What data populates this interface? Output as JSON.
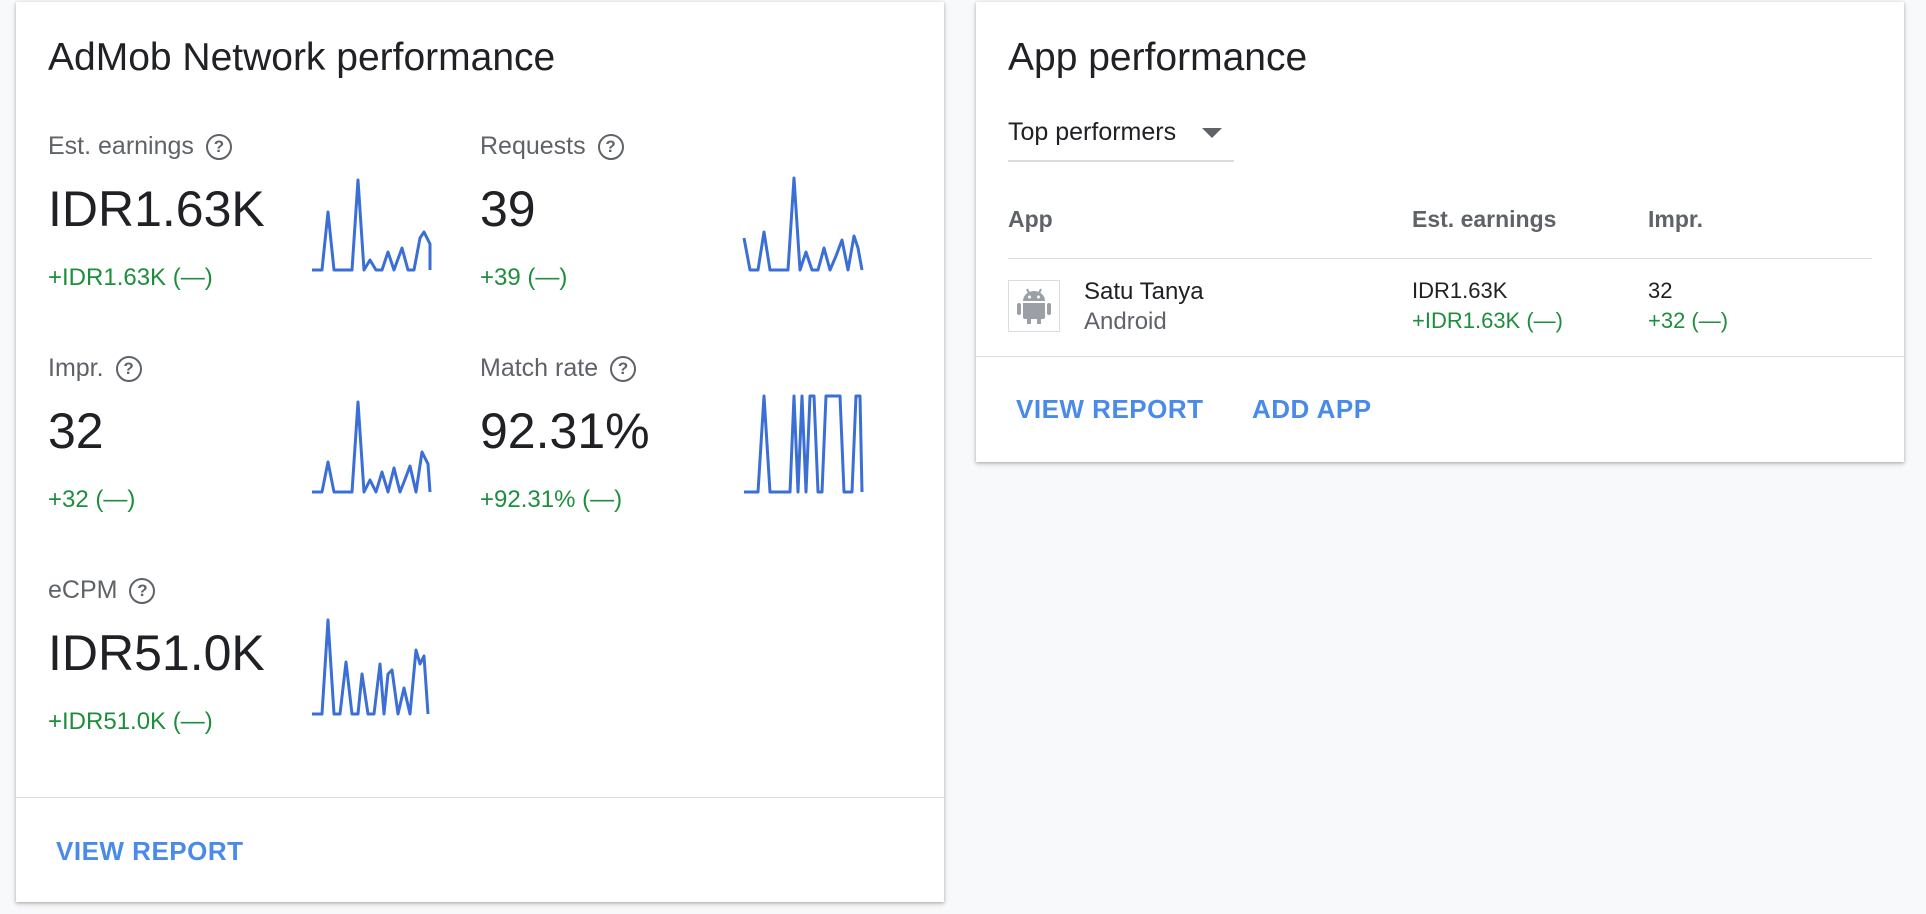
{
  "network_card": {
    "title": "AdMob Network performance",
    "help_glyph": "?",
    "line_color": "#3b6fd6",
    "delta_color": "#1e8e3e",
    "metrics": [
      {
        "label": "Est. earnings",
        "value": "IDR1.63K",
        "delta": "+IDR1.63K (—)",
        "trend": [
          0,
          0,
          0,
          0,
          0,
          0,
          0,
          0,
          0,
          0,
          0,
          0,
          0,
          0,
          0,
          0,
          0,
          0,
          0,
          0,
          0,
          0,
          0,
          0,
          0,
          0,
          0,
          0,
          0,
          0,
          0,
          0,
          0,
          0,
          0,
          0,
          0,
          0,
          0,
          0,
          0,
          0,
          0,
          0,
          0,
          0,
          0,
          0,
          0,
          0,
          0,
          0,
          0,
          0,
          0,
          0,
          0,
          0,
          0,
          0,
          0,
          0,
          0,
          0,
          0,
          0,
          0,
          0,
          0,
          0,
          0,
          0,
          0,
          0,
          0,
          0,
          0,
          0,
          0,
          0,
          0,
          0,
          0,
          0,
          0,
          0,
          0,
          0,
          0,
          0,
          0,
          0,
          0,
          0,
          0,
          0,
          0,
          0,
          0,
          0,
          0,
          0,
          0,
          0,
          0,
          0,
          0,
          0,
          0,
          0,
          0,
          0,
          0,
          0,
          0,
          0,
          0,
          0
        ]
      },
      {
        "label": "Requests",
        "value": "39",
        "delta": "+39 (—)",
        "trend": []
      },
      {
        "label": "Impr.",
        "value": "32",
        "delta": "+32 (—)",
        "trend": []
      },
      {
        "label": "Match rate",
        "value": "92.31%",
        "delta": "+92.31% (—)",
        "trend": []
      },
      {
        "label": "eCPM",
        "value": "IDR51.0K",
        "delta": "+IDR51.0K (—)",
        "trend": []
      }
    ],
    "view_report_label": "VIEW REPORT"
  },
  "sparklines": {
    "earnings": [
      0,
      0,
      0,
      0,
      0,
      0,
      0,
      0,
      0,
      0,
      0,
      0,
      0,
      0,
      0,
      0,
      0,
      0,
      0,
      0,
      0,
      0,
      0,
      0,
      0,
      0,
      0,
      0,
      0,
      0,
      0,
      0,
      0,
      0,
      0,
      0,
      0,
      0,
      0,
      0,
      0,
      0,
      0,
      0,
      0,
      0,
      0,
      0,
      0,
      0,
      0,
      0,
      0,
      0,
      0,
      0,
      0,
      0,
      0,
      0,
      0,
      0,
      0,
      0,
      0,
      0,
      0,
      0,
      0,
      0,
      0,
      0,
      0,
      0,
      0,
      0,
      0,
      0,
      0,
      0,
      0,
      0,
      0,
      0,
      0,
      0,
      0,
      0,
      0,
      0,
      0,
      0,
      0,
      0,
      0,
      0,
      0,
      0,
      0,
      0,
      0,
      0,
      0,
      0,
      0,
      0,
      0,
      0,
      0,
      0,
      0,
      0,
      0,
      0,
      0,
      0,
      0,
      0
    ],
    "requests": []
  },
  "app_card": {
    "title": "App performance",
    "filter_label": "Top performers",
    "columns": {
      "app": "App",
      "earnings": "Est. earnings",
      "impr": "Impr."
    },
    "row": {
      "name": "Satu Tanya",
      "platform": "Android",
      "icon": "android-icon",
      "earnings": "IDR1.63K",
      "earnings_delta": "+IDR1.63K (—)",
      "impr": "32",
      "impr_delta": "+32 (—)"
    },
    "view_report_label": "VIEW REPORT",
    "add_app_label": "ADD APP"
  }
}
